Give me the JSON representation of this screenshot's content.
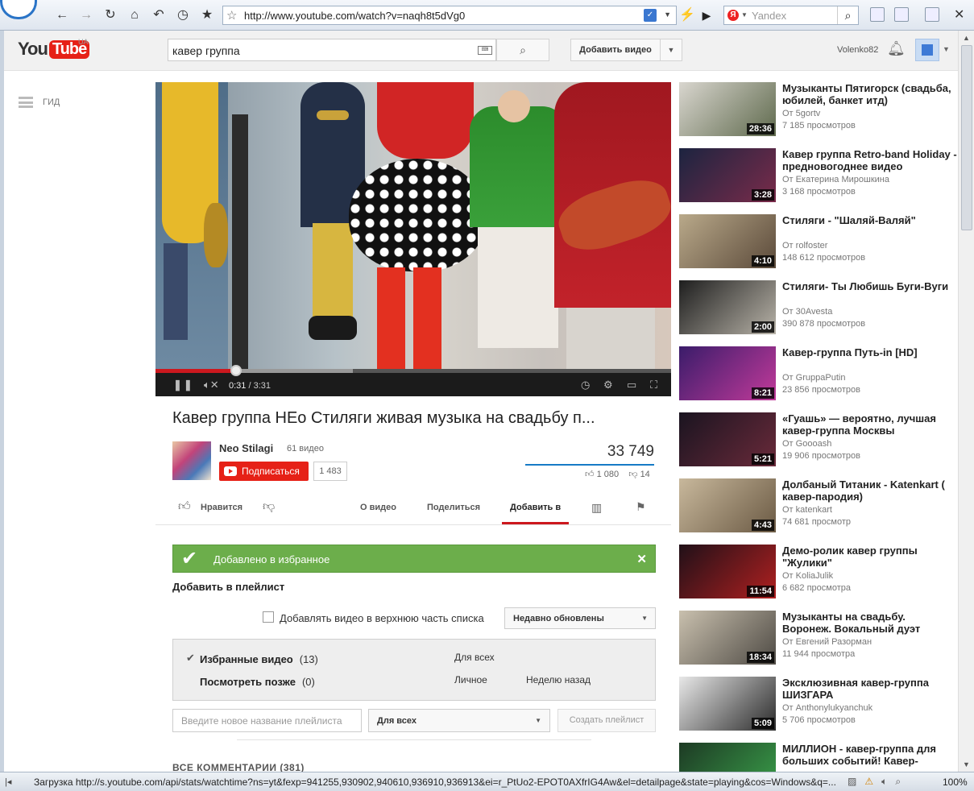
{
  "browser": {
    "url": "http://www.youtube.com/watch?v=naqh8t5dVg0",
    "search_engine": "Yandex",
    "status_text": "Загрузка http://s.youtube.com/api/stats/watchtime?ns=yt&fexp=941255,930902,940610,936910,936913&ei=r_PtUo2-EPOT0AXfrIG4Aw&el=detailpage&state=playing&cos=Windows&q=...",
    "zoom": "100%"
  },
  "masthead": {
    "logo_you": "You",
    "logo_tube": "Tube",
    "region": "UA",
    "search_value": "кавер группа",
    "upload_label": "Добавить видео",
    "username": "Volenko82"
  },
  "guide": {
    "label": "ГИД"
  },
  "player": {
    "current_time": "0:31",
    "separator": " / ",
    "duration": "3:31",
    "progress_fraction": 0.147
  },
  "video": {
    "title": "Кавер группа НЕо Стиляги живая музыка на свадьбу п...",
    "channel": "Neo Stilagi",
    "video_count": "61 видео",
    "subscribe_label": "Подписаться",
    "subscriber_count": "1 483",
    "views": "33 749",
    "likes": "1 080",
    "dislikes": "14"
  },
  "actions": {
    "like": "Нравится",
    "about": "О видео",
    "share": "Поделиться",
    "add_to": "Добавить в"
  },
  "add_panel": {
    "banner": "Добавлено в избранное",
    "title": "Добавить в плейлист",
    "checkbox_label": "Добавлять видео в верхнюю часть списка",
    "sort_value": "Недавно обновлены",
    "playlists": [
      {
        "name": "Избранные видео",
        "count": "(13)",
        "privacy": "Для всех",
        "updated": ""
      },
      {
        "name": "Посмотреть позже",
        "count": "(0)",
        "privacy": "Личное",
        "updated": "Неделю назад"
      }
    ],
    "new_playlist_placeholder": "Введите новое название плейлиста",
    "new_playlist_privacy": "Для всех",
    "create_label": "Создать плейлист"
  },
  "comments": {
    "title": "ВСЕ КОММЕНТАРИИ (381)"
  },
  "related": [
    {
      "title": "Музыканты Пятигорск (свадьба, юбилей, банкет итд)",
      "by_prefix": "От",
      "author": "5gortv",
      "views": "7 185 просмотров",
      "duration": "28:36",
      "c1": "#d9d6cf",
      "c2": "#5f6a4d"
    },
    {
      "title": "Кавер группа Retro-band Holiday - предновогоднее видео",
      "by_prefix": "От",
      "author": "Екатерина Мирошкина",
      "views": "3 168 просмотров",
      "duration": "3:28",
      "c1": "#1c2440",
      "c2": "#7a2b4a"
    },
    {
      "title": "Стиляги - \"Шаляй-Валяй\"",
      "by_prefix": "От",
      "author": "rolfoster",
      "views": "148 612 просмотров",
      "duration": "4:10",
      "c1": "#b9a98a",
      "c2": "#5b4a3a"
    },
    {
      "title": "Стиляги- Ты Любишь Буги-Вуги",
      "by_prefix": "От",
      "author": "30Avesta",
      "views": "390 878 просмотров",
      "duration": "2:00",
      "c1": "#1e1e1e",
      "c2": "#b8b3a8"
    },
    {
      "title": "Кавер-группа Путь-in [HD]",
      "by_prefix": "От",
      "author": "GruppaPutin",
      "views": "23 856 просмотров",
      "duration": "8:21",
      "c1": "#3a1c6a",
      "c2": "#c23a9a"
    },
    {
      "title": "«Гуашь» — вероятно, лучшая кавер-группа Москвы",
      "by_prefix": "От",
      "author": "Goooash",
      "views": "19 906 просмотров",
      "duration": "5:21",
      "c1": "#1a1420",
      "c2": "#6a2a3a"
    },
    {
      "title": "Долбаный Титаник - Katenkart ( кавер-пародия)",
      "by_prefix": "От",
      "author": "katenkart",
      "views": "74 681 просмотр",
      "duration": "4:43",
      "c1": "#c8b89c",
      "c2": "#6b5a44"
    },
    {
      "title": "Демо-ролик кавер группы \"Жулики\"",
      "by_prefix": "От",
      "author": "KoliaJulik",
      "views": "6 682 просмотра",
      "duration": "11:54",
      "c1": "#201018",
      "c2": "#b02020"
    },
    {
      "title": "Музыканты на свадьбу. Воронеж. Вокальный дуэт",
      "by_prefix": "От",
      "author": "Евгений Разорман",
      "views": "11 944 просмотра",
      "duration": "18:34",
      "c1": "#c9c0ae",
      "c2": "#4e4a44"
    },
    {
      "title": "Эксклюзивная кавер-группа ШИЗГАРА",
      "by_prefix": "От",
      "author": "Anthonylukyanchuk",
      "views": "5 706 просмотров",
      "duration": "5:09",
      "c1": "#e8e8e8",
      "c2": "#2a2a2a"
    },
    {
      "title": "МИЛЛИОН - кавер-группа для больших событий! Кавер-",
      "by_prefix": "",
      "author": "",
      "views": "",
      "duration": "",
      "c1": "#1d3a24",
      "c2": "#3aa04a"
    }
  ]
}
